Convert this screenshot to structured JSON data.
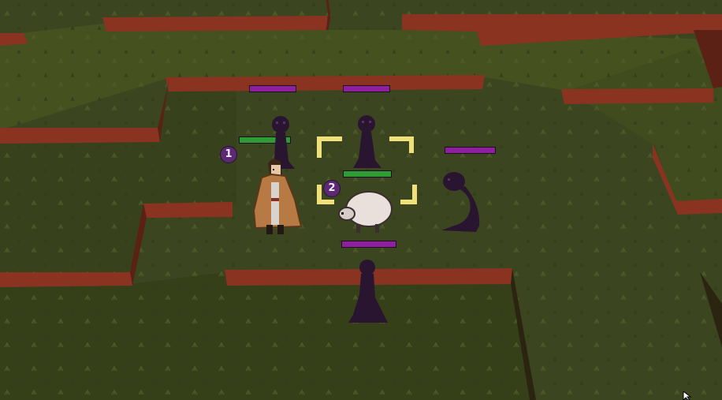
{
  "colors": {
    "grass": "#3b4620",
    "grass_light": "#45511f",
    "grass_dark": "#323c1b",
    "cliff": "#8a3321",
    "cliff_dark": "#5b2114",
    "enemy_hp": "#8e1f9e",
    "ally_hp": "#2f9b34",
    "selection": "#f0e07a",
    "shadow_creature": "#2a1530",
    "badge": "#5c2a73"
  },
  "hp_bars": [
    {
      "id": "enemy-hp-left",
      "type": "enemy",
      "fill": 1.0
    },
    {
      "id": "enemy-hp-center-top",
      "type": "enemy",
      "fill": 1.0
    },
    {
      "id": "ally-hp-hero",
      "type": "ally",
      "fill": 1.0
    },
    {
      "id": "ally-hp-sheep",
      "type": "ally",
      "fill": 1.0
    },
    {
      "id": "enemy-hp-right",
      "type": "enemy",
      "fill": 1.0
    },
    {
      "id": "enemy-hp-bottom",
      "type": "enemy",
      "fill": 1.0
    }
  ],
  "badges": {
    "hero": "1",
    "sheep": "2"
  },
  "icons": {
    "hero": "cloaked-hero-icon",
    "sheep": "sheep-icon",
    "shadow": "shadow-figure-icon",
    "serpent": "shadow-serpent-icon",
    "cursor": "mouse-cursor-icon"
  }
}
